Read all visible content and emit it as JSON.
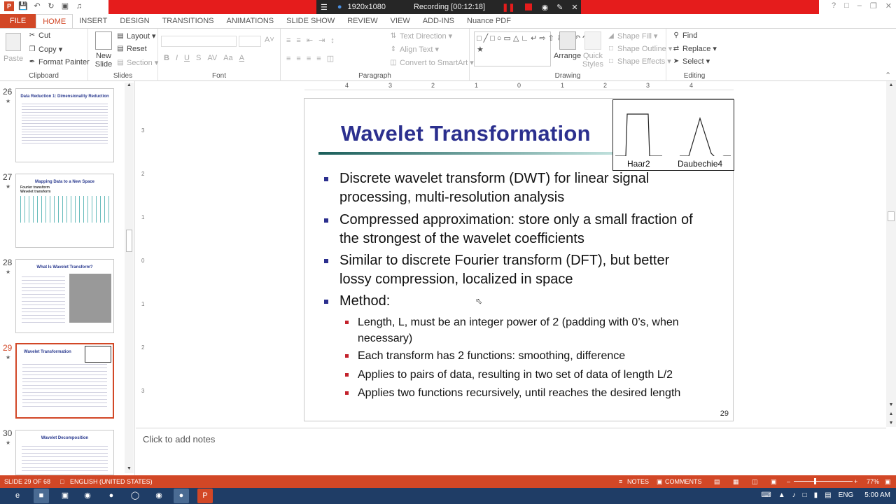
{
  "recording": {
    "resolution": "1920x1080",
    "status": "Recording [00:12:18]"
  },
  "tabs": [
    "FILE",
    "HOME",
    "INSERT",
    "DESIGN",
    "TRANSITIONS",
    "ANIMATIONS",
    "SLIDE SHOW",
    "REVIEW",
    "VIEW",
    "ADD-INS",
    "Nuance PDF"
  ],
  "active_tab": "HOME",
  "ribbon": {
    "clipboard": {
      "paste": "Paste",
      "cut": "Cut",
      "copy": "Copy",
      "format_painter": "Format Painter",
      "label": "Clipboard"
    },
    "slides": {
      "new_slide": "New Slide",
      "layout": "Layout",
      "reset": "Reset",
      "section": "Section",
      "label": "Slides"
    },
    "font": {
      "label": "Font"
    },
    "paragraph": {
      "text_direction": "Text Direction",
      "align_text": "Align Text",
      "convert": "Convert to SmartArt",
      "label": "Paragraph"
    },
    "drawing": {
      "arrange": "Arrange",
      "quick_styles": "Quick Styles",
      "shape_fill": "Shape Fill",
      "shape_outline": "Shape Outline",
      "shape_effects": "Shape Effects",
      "label": "Drawing"
    },
    "editing": {
      "find": "Find",
      "replace": "Replace",
      "select": "Select",
      "label": "Editing"
    }
  },
  "thumbnails": [
    {
      "num": "26",
      "title": "Data Reduction 1: Dimensionality Reduction"
    },
    {
      "num": "27",
      "title": "Mapping Data to a New Space",
      "lines": [
        "Fourier transform",
        "Wavelet transform"
      ]
    },
    {
      "num": "28",
      "title": "What Is Wavelet Transform?"
    },
    {
      "num": "29",
      "title": "Wavelet Transformation"
    },
    {
      "num": "30",
      "title": "Wavelet Decomposition"
    }
  ],
  "slide": {
    "title": "Wavelet Transformation",
    "figure_labels": [
      "Haar2",
      "Daubechie4"
    ],
    "bullets": [
      "Discrete wavelet transform (DWT) for linear signal processing, multi-resolution analysis",
      "Compressed approximation: store only a small fraction of the strongest of the wavelet coefficients",
      "Similar to discrete Fourier transform (DFT), but better lossy compression, localized in space",
      "Method:"
    ],
    "sub_bullets": [
      "Length, L, must be an integer power of 2 (padding with 0’s, when necessary)",
      "Each transform has 2 functions: smoothing, difference",
      "Applies to pairs of data, resulting in two set of data of length L/2",
      "Applies two functions recursively, until reaches the desired length"
    ],
    "number": "29"
  },
  "notes_placeholder": "Click to add notes",
  "status": {
    "slide": "SLIDE 29 OF 68",
    "language": "ENGLISH (UNITED STATES)",
    "notes": "NOTES",
    "comments": "COMMENTS",
    "zoom": "77%"
  },
  "tray": {
    "lang": "ENG",
    "time": "5:00 AM"
  },
  "ruler_h": [
    "4",
    "3",
    "2",
    "1",
    "0",
    "1",
    "2",
    "3",
    "4"
  ],
  "ruler_v": [
    "3",
    "2",
    "1",
    "0",
    "1",
    "2",
    "3"
  ]
}
